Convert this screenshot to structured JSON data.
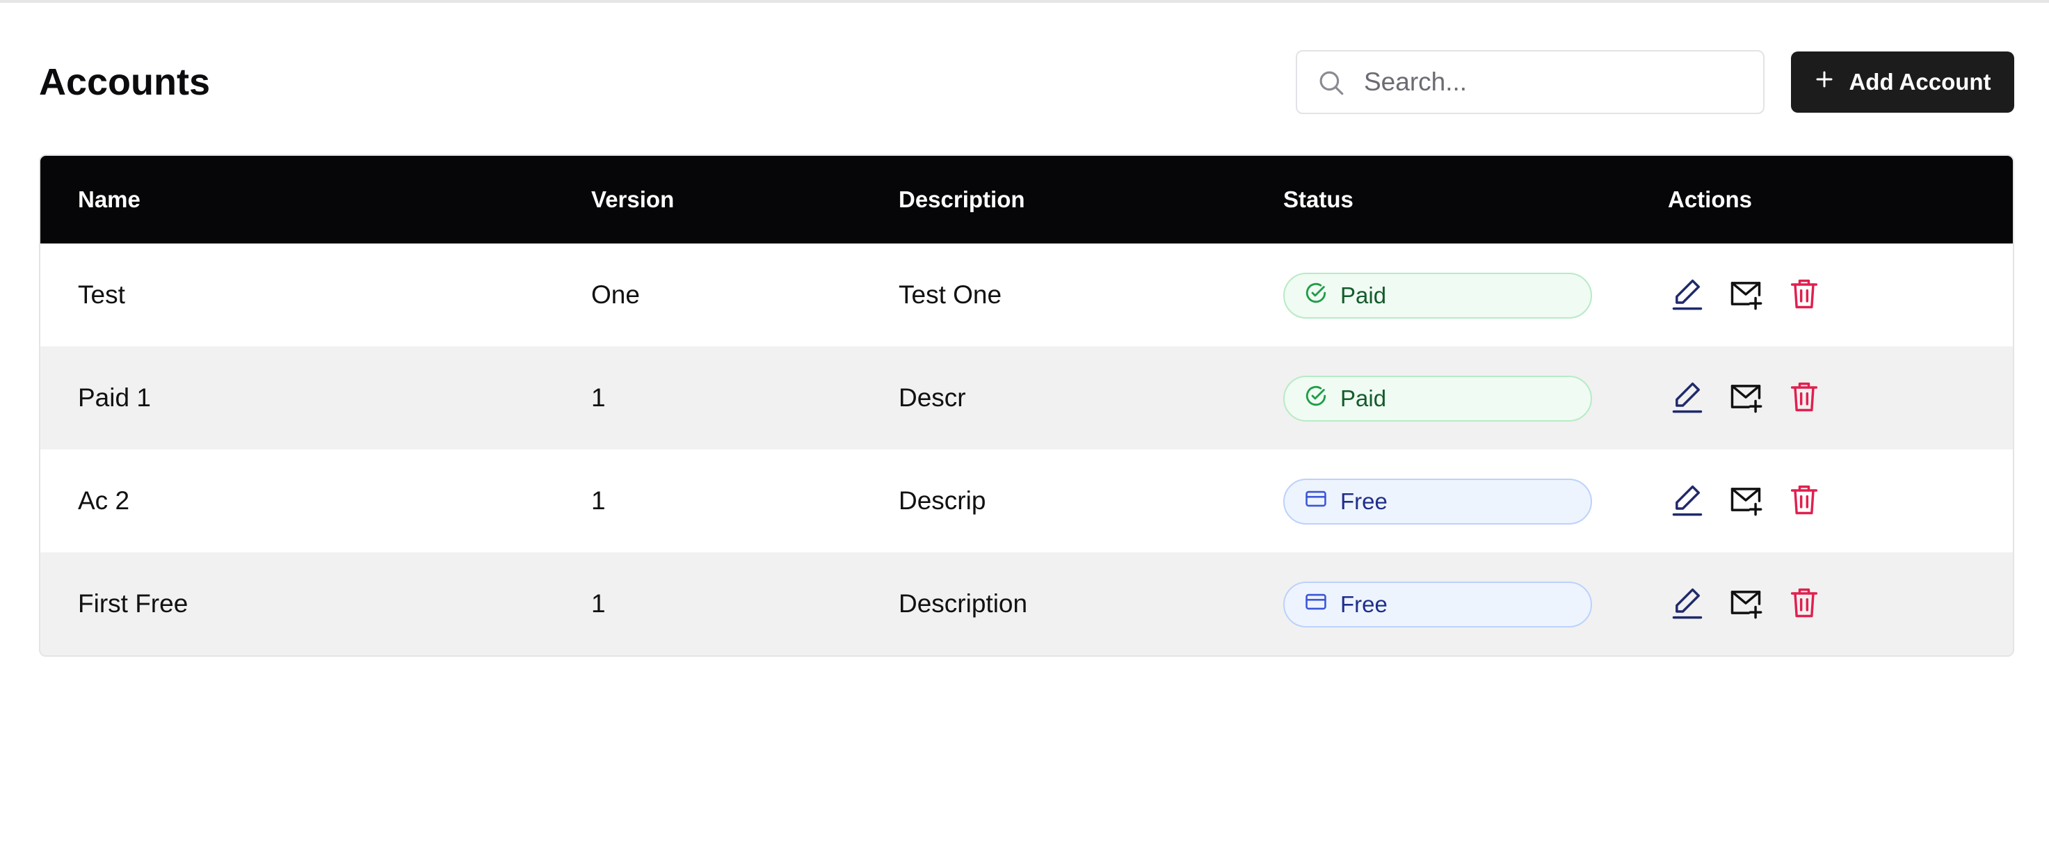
{
  "page": {
    "title": "Accounts"
  },
  "search": {
    "placeholder": "Search...",
    "icon": "search-icon"
  },
  "add_button": {
    "label": "Add Account",
    "icon": "plus-icon"
  },
  "table": {
    "columns": [
      "Name",
      "Version",
      "Description",
      "Status",
      "Actions"
    ],
    "rows": [
      {
        "name": "Test",
        "version": "One",
        "description": "Test One",
        "status": "Paid",
        "status_kind": "paid"
      },
      {
        "name": "Paid 1",
        "version": "1",
        "description": "Descr",
        "status": "Paid",
        "status_kind": "paid"
      },
      {
        "name": "Ac 2",
        "version": "1",
        "description": "Descrip",
        "status": "Free",
        "status_kind": "free"
      },
      {
        "name": "First Free",
        "version": "1",
        "description": "Description",
        "status": "Free",
        "status_kind": "free"
      }
    ],
    "row_actions": [
      "edit-icon",
      "mail-plus-icon",
      "trash-icon"
    ]
  },
  "colors": {
    "header_bg": "#060609",
    "button_bg": "#1c1c1c",
    "paid_text": "#145c2c",
    "paid_icon": "#1f9d48",
    "free_text": "#1f2f8c",
    "free_icon": "#3b55d6",
    "edit_icon": "#1f2a6b",
    "delete_icon": "#e0204f",
    "alt_row": "#f1f1f1"
  }
}
